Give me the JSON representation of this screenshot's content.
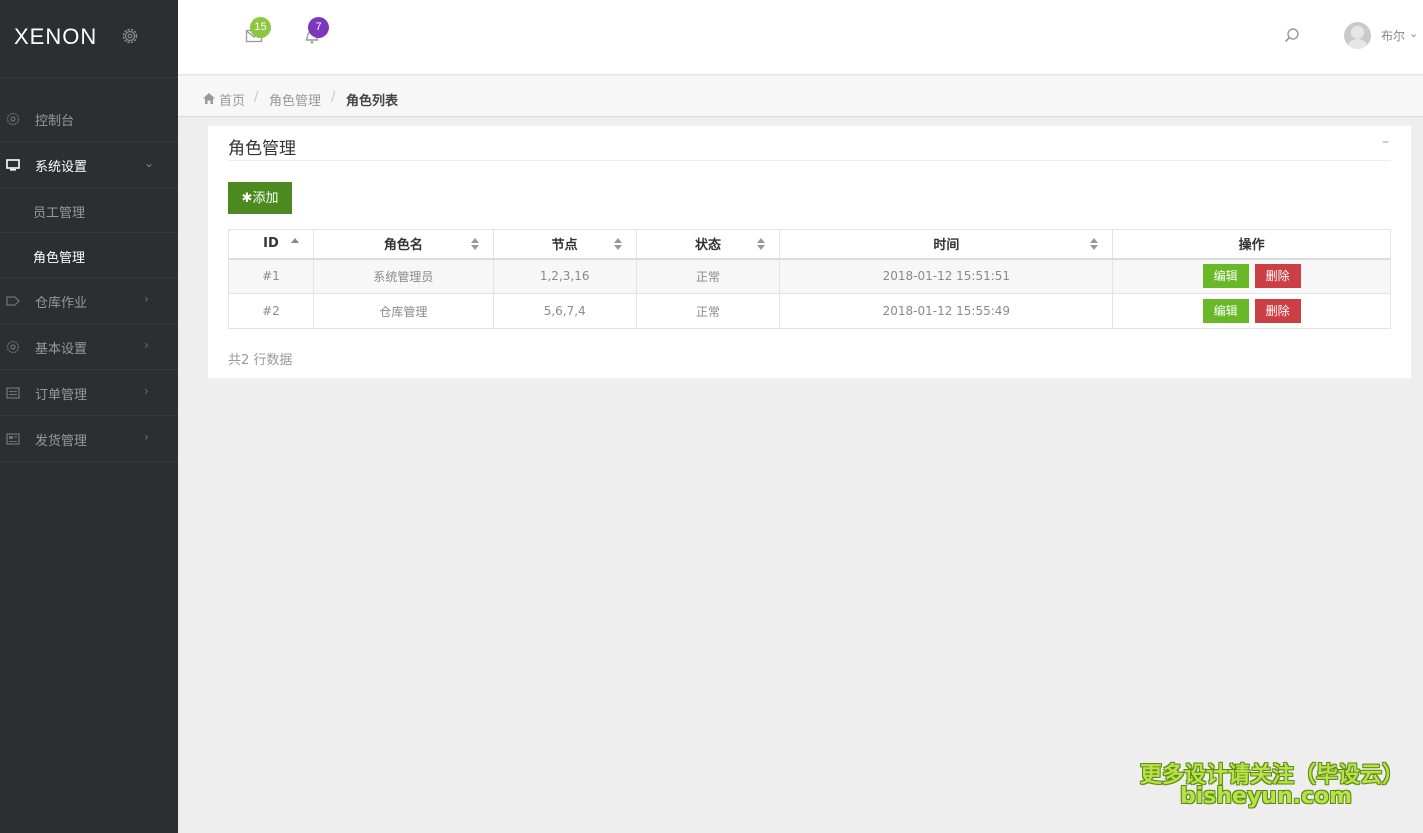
{
  "brand": {
    "logo_text": "XENON"
  },
  "sidebar": {
    "items": [
      {
        "label": "控制台",
        "icon": "dashboard-icon"
      },
      {
        "label": "系统设置",
        "icon": "monitor-icon",
        "expanded": true,
        "children": [
          {
            "label": "员工管理"
          },
          {
            "label": "角色管理",
            "current": true
          }
        ]
      },
      {
        "label": "仓库作业",
        "icon": "tag-icon"
      },
      {
        "label": "基本设置",
        "icon": "gear-icon"
      },
      {
        "label": "订单管理",
        "icon": "list-icon"
      },
      {
        "label": "发货管理",
        "icon": "newspaper-icon"
      }
    ]
  },
  "topbar": {
    "mail_count": "15",
    "notification_count": "7",
    "user_name": "布尔",
    "mail_badge_color": "#8dc63f",
    "notify_badge_color": "#7c38bc"
  },
  "breadcrumb": {
    "home": "首页",
    "level1": "角色管理",
    "current": "角色列表",
    "separator": "/"
  },
  "panel": {
    "title": "角色管理",
    "collapse": "–",
    "add_label": "✱添加",
    "columns": [
      "ID",
      "角色名",
      "节点",
      "状态",
      "时间",
      "操作"
    ],
    "rows": [
      {
        "id": "#1",
        "name": "系统管理员",
        "nodes": "1,2,3,16",
        "status": "正常",
        "time": "2018-01-12 15:51:51"
      },
      {
        "id": "#2",
        "name": "仓库管理",
        "nodes": "5,6,7,4",
        "status": "正常",
        "time": "2018-01-12 15:55:49"
      }
    ],
    "edit_label": "编辑",
    "delete_label": "删除",
    "total_text": "共2 行数据"
  },
  "watermark": {
    "line1": "更多设计请关注（毕设云）",
    "line2": "bisheyun.com"
  }
}
